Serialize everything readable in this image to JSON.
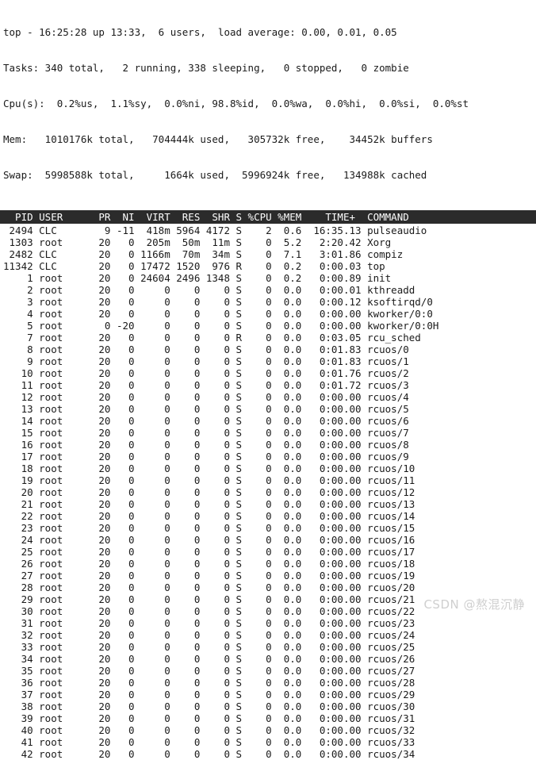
{
  "app": {
    "name": "top",
    "terminal_background": "#ffffff",
    "text_color": "#1a1a1a",
    "header_background": "#2b2b2b",
    "header_text_color": "#ffffff"
  },
  "summary": {
    "uptime_line": "top - 16:25:28 up 13:33,  6 users,  load average: 0.00, 0.01, 0.05",
    "tasks_line": "Tasks: 340 total,   2 running, 338 sleeping,   0 stopped,   0 zombie",
    "cpu_line": "Cpu(s):  0.2%us,  1.1%sy,  0.0%ni, 98.8%id,  0.0%wa,  0.0%hi,  0.0%si,  0.0%st",
    "mem_line": "Mem:   1010176k total,   704444k used,   305732k free,    34452k buffers",
    "swap_line": "Swap:  5998588k total,     1664k used,  5996924k free,   134988k cached",
    "fields": {
      "time": "16:25:28",
      "uptime": "13:33",
      "users": "6",
      "load_average": [
        "0.00",
        "0.01",
        "0.05"
      ],
      "tasks_total": "340",
      "tasks_running": "2",
      "tasks_sleeping": "338",
      "tasks_stopped": "0",
      "tasks_zombie": "0",
      "cpu_us": "0.2",
      "cpu_sy": "1.1",
      "cpu_ni": "0.0",
      "cpu_id": "98.8",
      "cpu_wa": "0.0",
      "cpu_hi": "0.0",
      "cpu_si": "0.0",
      "cpu_st": "0.0",
      "mem_total": "1010176k",
      "mem_used": "704444k",
      "mem_free": "305732k",
      "mem_buffers": "34452k",
      "swap_total": "5998588k",
      "swap_used": "1664k",
      "swap_free": "5996924k",
      "swap_cached": "134988k"
    }
  },
  "table": {
    "header_line": "  PID USER      PR  NI  VIRT  RES  SHR S %CPU %MEM    TIME+  COMMAND",
    "columns": [
      "PID",
      "USER",
      "PR",
      "NI",
      "VIRT",
      "RES",
      "SHR",
      "S",
      "%CPU",
      "%MEM",
      "TIME+",
      "COMMAND"
    ],
    "rows": [
      {
        "line": " 2494 CLC        9 -11  418m 5964 4172 S    2  0.6  16:35.13 pulseaudio",
        "pid": "2494",
        "user": "CLC",
        "pr": "9",
        "ni": "-11",
        "virt": "418m",
        "res": "5964",
        "shr": "4172",
        "s": "S",
        "cpu": "2",
        "mem": "0.6",
        "time": "16:35.13",
        "command": "pulseaudio"
      },
      {
        "line": " 1303 root      20   0  205m  50m  11m S    0  5.2   2:20.42 Xorg",
        "pid": "1303",
        "user": "root",
        "pr": "20",
        "ni": "0",
        "virt": "205m",
        "res": "50m",
        "shr": "11m",
        "s": "S",
        "cpu": "0",
        "mem": "5.2",
        "time": "2:20.42",
        "command": "Xorg"
      },
      {
        "line": " 2482 CLC       20   0 1166m  70m  34m S    0  7.1   3:01.86 compiz",
        "pid": "2482",
        "user": "CLC",
        "pr": "20",
        "ni": "0",
        "virt": "1166m",
        "res": "70m",
        "shr": "34m",
        "s": "S",
        "cpu": "0",
        "mem": "7.1",
        "time": "3:01.86",
        "command": "compiz"
      },
      {
        "line": "11342 CLC       20   0 17472 1520  976 R    0  0.2   0:00.03 top",
        "pid": "11342",
        "user": "CLC",
        "pr": "20",
        "ni": "0",
        "virt": "17472",
        "res": "1520",
        "shr": "976",
        "s": "R",
        "cpu": "0",
        "mem": "0.2",
        "time": "0:00.03",
        "command": "top"
      },
      {
        "line": "    1 root      20   0 24604 2496 1348 S    0  0.2   0:00.89 init",
        "pid": "1",
        "user": "root",
        "pr": "20",
        "ni": "0",
        "virt": "24604",
        "res": "2496",
        "shr": "1348",
        "s": "S",
        "cpu": "0",
        "mem": "0.2",
        "time": "0:00.89",
        "command": "init"
      },
      {
        "line": "    2 root      20   0     0    0    0 S    0  0.0   0:00.01 kthreadd",
        "pid": "2",
        "user": "root",
        "pr": "20",
        "ni": "0",
        "virt": "0",
        "res": "0",
        "shr": "0",
        "s": "S",
        "cpu": "0",
        "mem": "0.0",
        "time": "0:00.01",
        "command": "kthreadd"
      },
      {
        "line": "    3 root      20   0     0    0    0 S    0  0.0   0:00.12 ksoftirqd/0",
        "pid": "3",
        "user": "root",
        "pr": "20",
        "ni": "0",
        "virt": "0",
        "res": "0",
        "shr": "0",
        "s": "S",
        "cpu": "0",
        "mem": "0.0",
        "time": "0:00.12",
        "command": "ksoftirqd/0"
      },
      {
        "line": "    4 root      20   0     0    0    0 S    0  0.0   0:00.00 kworker/0:0",
        "pid": "4",
        "user": "root",
        "pr": "20",
        "ni": "0",
        "virt": "0",
        "res": "0",
        "shr": "0",
        "s": "S",
        "cpu": "0",
        "mem": "0.0",
        "time": "0:00.00",
        "command": "kworker/0:0"
      },
      {
        "line": "    5 root       0 -20     0    0    0 S    0  0.0   0:00.00 kworker/0:0H",
        "pid": "5",
        "user": "root",
        "pr": "0",
        "ni": "-20",
        "virt": "0",
        "res": "0",
        "shr": "0",
        "s": "S",
        "cpu": "0",
        "mem": "0.0",
        "time": "0:00.00",
        "command": "kworker/0:0H"
      },
      {
        "line": "    7 root      20   0     0    0    0 R    0  0.0   0:03.05 rcu_sched",
        "pid": "7",
        "user": "root",
        "pr": "20",
        "ni": "0",
        "virt": "0",
        "res": "0",
        "shr": "0",
        "s": "R",
        "cpu": "0",
        "mem": "0.0",
        "time": "0:03.05",
        "command": "rcu_sched"
      },
      {
        "line": "    8 root      20   0     0    0    0 S    0  0.0   0:01.83 rcuos/0",
        "pid": "8",
        "user": "root",
        "pr": "20",
        "ni": "0",
        "virt": "0",
        "res": "0",
        "shr": "0",
        "s": "S",
        "cpu": "0",
        "mem": "0.0",
        "time": "0:01.83",
        "command": "rcuos/0"
      },
      {
        "line": "    9 root      20   0     0    0    0 S    0  0.0   0:01.83 rcuos/1",
        "pid": "9",
        "user": "root",
        "pr": "20",
        "ni": "0",
        "virt": "0",
        "res": "0",
        "shr": "0",
        "s": "S",
        "cpu": "0",
        "mem": "0.0",
        "time": "0:01.83",
        "command": "rcuos/1"
      },
      {
        "line": "   10 root      20   0     0    0    0 S    0  0.0   0:01.76 rcuos/2",
        "pid": "10",
        "user": "root",
        "pr": "20",
        "ni": "0",
        "virt": "0",
        "res": "0",
        "shr": "0",
        "s": "S",
        "cpu": "0",
        "mem": "0.0",
        "time": "0:01.76",
        "command": "rcuos/2"
      },
      {
        "line": "   11 root      20   0     0    0    0 S    0  0.0   0:01.72 rcuos/3",
        "pid": "11",
        "user": "root",
        "pr": "20",
        "ni": "0",
        "virt": "0",
        "res": "0",
        "shr": "0",
        "s": "S",
        "cpu": "0",
        "mem": "0.0",
        "time": "0:01.72",
        "command": "rcuos/3"
      },
      {
        "line": "   12 root      20   0     0    0    0 S    0  0.0   0:00.00 rcuos/4",
        "pid": "12",
        "user": "root",
        "pr": "20",
        "ni": "0",
        "virt": "0",
        "res": "0",
        "shr": "0",
        "s": "S",
        "cpu": "0",
        "mem": "0.0",
        "time": "0:00.00",
        "command": "rcuos/4"
      },
      {
        "line": "   13 root      20   0     0    0    0 S    0  0.0   0:00.00 rcuos/5",
        "pid": "13",
        "user": "root",
        "pr": "20",
        "ni": "0",
        "virt": "0",
        "res": "0",
        "shr": "0",
        "s": "S",
        "cpu": "0",
        "mem": "0.0",
        "time": "0:00.00",
        "command": "rcuos/5"
      },
      {
        "line": "   14 root      20   0     0    0    0 S    0  0.0   0:00.00 rcuos/6",
        "pid": "14",
        "user": "root",
        "pr": "20",
        "ni": "0",
        "virt": "0",
        "res": "0",
        "shr": "0",
        "s": "S",
        "cpu": "0",
        "mem": "0.0",
        "time": "0:00.00",
        "command": "rcuos/6"
      },
      {
        "line": "   15 root      20   0     0    0    0 S    0  0.0   0:00.00 rcuos/7",
        "pid": "15",
        "user": "root",
        "pr": "20",
        "ni": "0",
        "virt": "0",
        "res": "0",
        "shr": "0",
        "s": "S",
        "cpu": "0",
        "mem": "0.0",
        "time": "0:00.00",
        "command": "rcuos/7"
      },
      {
        "line": "   16 root      20   0     0    0    0 S    0  0.0   0:00.00 rcuos/8",
        "pid": "16",
        "user": "root",
        "pr": "20",
        "ni": "0",
        "virt": "0",
        "res": "0",
        "shr": "0",
        "s": "S",
        "cpu": "0",
        "mem": "0.0",
        "time": "0:00.00",
        "command": "rcuos/8"
      },
      {
        "line": "   17 root      20   0     0    0    0 S    0  0.0   0:00.00 rcuos/9",
        "pid": "17",
        "user": "root",
        "pr": "20",
        "ni": "0",
        "virt": "0",
        "res": "0",
        "shr": "0",
        "s": "S",
        "cpu": "0",
        "mem": "0.0",
        "time": "0:00.00",
        "command": "rcuos/9"
      },
      {
        "line": "   18 root      20   0     0    0    0 S    0  0.0   0:00.00 rcuos/10",
        "pid": "18",
        "user": "root",
        "pr": "20",
        "ni": "0",
        "virt": "0",
        "res": "0",
        "shr": "0",
        "s": "S",
        "cpu": "0",
        "mem": "0.0",
        "time": "0:00.00",
        "command": "rcuos/10"
      },
      {
        "line": "   19 root      20   0     0    0    0 S    0  0.0   0:00.00 rcuos/11",
        "pid": "19",
        "user": "root",
        "pr": "20",
        "ni": "0",
        "virt": "0",
        "res": "0",
        "shr": "0",
        "s": "S",
        "cpu": "0",
        "mem": "0.0",
        "time": "0:00.00",
        "command": "rcuos/11"
      },
      {
        "line": "   20 root      20   0     0    0    0 S    0  0.0   0:00.00 rcuos/12",
        "pid": "20",
        "user": "root",
        "pr": "20",
        "ni": "0",
        "virt": "0",
        "res": "0",
        "shr": "0",
        "s": "S",
        "cpu": "0",
        "mem": "0.0",
        "time": "0:00.00",
        "command": "rcuos/12"
      },
      {
        "line": "   21 root      20   0     0    0    0 S    0  0.0   0:00.00 rcuos/13",
        "pid": "21",
        "user": "root",
        "pr": "20",
        "ni": "0",
        "virt": "0",
        "res": "0",
        "shr": "0",
        "s": "S",
        "cpu": "0",
        "mem": "0.0",
        "time": "0:00.00",
        "command": "rcuos/13"
      },
      {
        "line": "   22 root      20   0     0    0    0 S    0  0.0   0:00.00 rcuos/14",
        "pid": "22",
        "user": "root",
        "pr": "20",
        "ni": "0",
        "virt": "0",
        "res": "0",
        "shr": "0",
        "s": "S",
        "cpu": "0",
        "mem": "0.0",
        "time": "0:00.00",
        "command": "rcuos/14"
      },
      {
        "line": "   23 root      20   0     0    0    0 S    0  0.0   0:00.00 rcuos/15",
        "pid": "23",
        "user": "root",
        "pr": "20",
        "ni": "0",
        "virt": "0",
        "res": "0",
        "shr": "0",
        "s": "S",
        "cpu": "0",
        "mem": "0.0",
        "time": "0:00.00",
        "command": "rcuos/15"
      },
      {
        "line": "   24 root      20   0     0    0    0 S    0  0.0   0:00.00 rcuos/16",
        "pid": "24",
        "user": "root",
        "pr": "20",
        "ni": "0",
        "virt": "0",
        "res": "0",
        "shr": "0",
        "s": "S",
        "cpu": "0",
        "mem": "0.0",
        "time": "0:00.00",
        "command": "rcuos/16"
      },
      {
        "line": "   25 root      20   0     0    0    0 S    0  0.0   0:00.00 rcuos/17",
        "pid": "25",
        "user": "root",
        "pr": "20",
        "ni": "0",
        "virt": "0",
        "res": "0",
        "shr": "0",
        "s": "S",
        "cpu": "0",
        "mem": "0.0",
        "time": "0:00.00",
        "command": "rcuos/17"
      },
      {
        "line": "   26 root      20   0     0    0    0 S    0  0.0   0:00.00 rcuos/18",
        "pid": "26",
        "user": "root",
        "pr": "20",
        "ni": "0",
        "virt": "0",
        "res": "0",
        "shr": "0",
        "s": "S",
        "cpu": "0",
        "mem": "0.0",
        "time": "0:00.00",
        "command": "rcuos/18"
      },
      {
        "line": "   27 root      20   0     0    0    0 S    0  0.0   0:00.00 rcuos/19",
        "pid": "27",
        "user": "root",
        "pr": "20",
        "ni": "0",
        "virt": "0",
        "res": "0",
        "shr": "0",
        "s": "S",
        "cpu": "0",
        "mem": "0.0",
        "time": "0:00.00",
        "command": "rcuos/19"
      },
      {
        "line": "   28 root      20   0     0    0    0 S    0  0.0   0:00.00 rcuos/20",
        "pid": "28",
        "user": "root",
        "pr": "20",
        "ni": "0",
        "virt": "0",
        "res": "0",
        "shr": "0",
        "s": "S",
        "cpu": "0",
        "mem": "0.0",
        "time": "0:00.00",
        "command": "rcuos/20"
      },
      {
        "line": "   29 root      20   0     0    0    0 S    0  0.0   0:00.00 rcuos/21",
        "pid": "29",
        "user": "root",
        "pr": "20",
        "ni": "0",
        "virt": "0",
        "res": "0",
        "shr": "0",
        "s": "S",
        "cpu": "0",
        "mem": "0.0",
        "time": "0:00.00",
        "command": "rcuos/21"
      },
      {
        "line": "   30 root      20   0     0    0    0 S    0  0.0   0:00.00 rcuos/22",
        "pid": "30",
        "user": "root",
        "pr": "20",
        "ni": "0",
        "virt": "0",
        "res": "0",
        "shr": "0",
        "s": "S",
        "cpu": "0",
        "mem": "0.0",
        "time": "0:00.00",
        "command": "rcuos/22"
      },
      {
        "line": "   31 root      20   0     0    0    0 S    0  0.0   0:00.00 rcuos/23",
        "pid": "31",
        "user": "root",
        "pr": "20",
        "ni": "0",
        "virt": "0",
        "res": "0",
        "shr": "0",
        "s": "S",
        "cpu": "0",
        "mem": "0.0",
        "time": "0:00.00",
        "command": "rcuos/23"
      },
      {
        "line": "   32 root      20   0     0    0    0 S    0  0.0   0:00.00 rcuos/24",
        "pid": "32",
        "user": "root",
        "pr": "20",
        "ni": "0",
        "virt": "0",
        "res": "0",
        "shr": "0",
        "s": "S",
        "cpu": "0",
        "mem": "0.0",
        "time": "0:00.00",
        "command": "rcuos/24"
      },
      {
        "line": "   33 root      20   0     0    0    0 S    0  0.0   0:00.00 rcuos/25",
        "pid": "33",
        "user": "root",
        "pr": "20",
        "ni": "0",
        "virt": "0",
        "res": "0",
        "shr": "0",
        "s": "S",
        "cpu": "0",
        "mem": "0.0",
        "time": "0:00.00",
        "command": "rcuos/25"
      },
      {
        "line": "   34 root      20   0     0    0    0 S    0  0.0   0:00.00 rcuos/26",
        "pid": "34",
        "user": "root",
        "pr": "20",
        "ni": "0",
        "virt": "0",
        "res": "0",
        "shr": "0",
        "s": "S",
        "cpu": "0",
        "mem": "0.0",
        "time": "0:00.00",
        "command": "rcuos/26"
      },
      {
        "line": "   35 root      20   0     0    0    0 S    0  0.0   0:00.00 rcuos/27",
        "pid": "35",
        "user": "root",
        "pr": "20",
        "ni": "0",
        "virt": "0",
        "res": "0",
        "shr": "0",
        "s": "S",
        "cpu": "0",
        "mem": "0.0",
        "time": "0:00.00",
        "command": "rcuos/27"
      },
      {
        "line": "   36 root      20   0     0    0    0 S    0  0.0   0:00.00 rcuos/28",
        "pid": "36",
        "user": "root",
        "pr": "20",
        "ni": "0",
        "virt": "0",
        "res": "0",
        "shr": "0",
        "s": "S",
        "cpu": "0",
        "mem": "0.0",
        "time": "0:00.00",
        "command": "rcuos/28"
      },
      {
        "line": "   37 root      20   0     0    0    0 S    0  0.0   0:00.00 rcuos/29",
        "pid": "37",
        "user": "root",
        "pr": "20",
        "ni": "0",
        "virt": "0",
        "res": "0",
        "shr": "0",
        "s": "S",
        "cpu": "0",
        "mem": "0.0",
        "time": "0:00.00",
        "command": "rcuos/29"
      },
      {
        "line": "   38 root      20   0     0    0    0 S    0  0.0   0:00.00 rcuos/30",
        "pid": "38",
        "user": "root",
        "pr": "20",
        "ni": "0",
        "virt": "0",
        "res": "0",
        "shr": "0",
        "s": "S",
        "cpu": "0",
        "mem": "0.0",
        "time": "0:00.00",
        "command": "rcuos/30"
      },
      {
        "line": "   39 root      20   0     0    0    0 S    0  0.0   0:00.00 rcuos/31",
        "pid": "39",
        "user": "root",
        "pr": "20",
        "ni": "0",
        "virt": "0",
        "res": "0",
        "shr": "0",
        "s": "S",
        "cpu": "0",
        "mem": "0.0",
        "time": "0:00.00",
        "command": "rcuos/31"
      },
      {
        "line": "   40 root      20   0     0    0    0 S    0  0.0   0:00.00 rcuos/32",
        "pid": "40",
        "user": "root",
        "pr": "20",
        "ni": "0",
        "virt": "0",
        "res": "0",
        "shr": "0",
        "s": "S",
        "cpu": "0",
        "mem": "0.0",
        "time": "0:00.00",
        "command": "rcuos/32"
      },
      {
        "line": "   41 root      20   0     0    0    0 S    0  0.0   0:00.00 rcuos/33",
        "pid": "41",
        "user": "root",
        "pr": "20",
        "ni": "0",
        "virt": "0",
        "res": "0",
        "shr": "0",
        "s": "S",
        "cpu": "0",
        "mem": "0.0",
        "time": "0:00.00",
        "command": "rcuos/33"
      },
      {
        "line": "   42 root      20   0     0    0    0 S    0  0.0   0:00.00 rcuos/34",
        "pid": "42",
        "user": "root",
        "pr": "20",
        "ni": "0",
        "virt": "0",
        "res": "0",
        "shr": "0",
        "s": "S",
        "cpu": "0",
        "mem": "0.0",
        "time": "0:00.00",
        "command": "rcuos/34"
      }
    ]
  },
  "watermark": {
    "text": "CSDN @熬混沉静"
  }
}
